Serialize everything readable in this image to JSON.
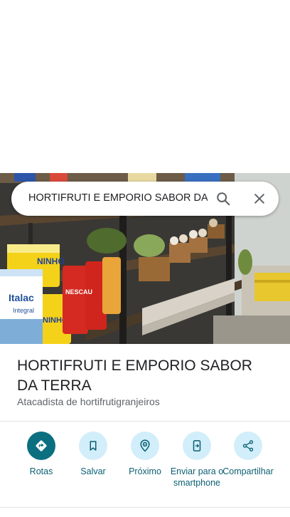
{
  "search": {
    "query": "HORTIFRUTI E EMPORIO SABOR DA"
  },
  "place": {
    "name": "HORTIFRUTI E EMPORIO SABOR DA TERRA",
    "category": "Atacadista de hortifrutigranjeiros"
  },
  "product_labels": {
    "italac": "Italac",
    "italac_sub": "Integral",
    "ninho": "NINHO",
    "nescau": "NESCAU"
  },
  "actions": [
    {
      "label": "Rotas",
      "icon": "directions-icon"
    },
    {
      "label": "Salvar",
      "icon": "bookmark-icon"
    },
    {
      "label": "Próximo",
      "icon": "nearby-icon"
    },
    {
      "label": "Enviar para o smartphone",
      "icon": "send-to-phone-icon"
    },
    {
      "label": "Compartilhar",
      "icon": "share-icon"
    }
  ],
  "colors": {
    "accent": "#0b6f80",
    "action_bg": "#d2eefa",
    "label": "#0b5f72"
  }
}
